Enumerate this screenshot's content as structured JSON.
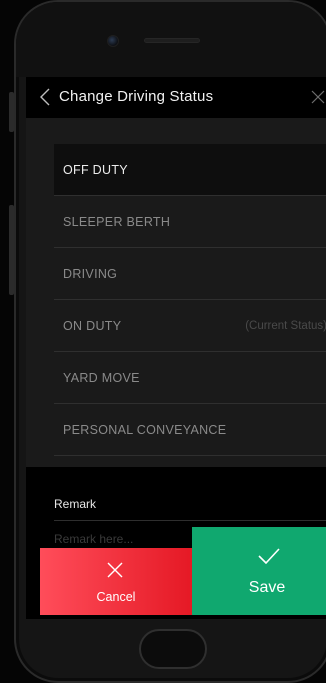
{
  "header": {
    "title": "Change Driving Status",
    "back_icon": "chevron-left-icon",
    "close_icon": "close-icon"
  },
  "statuses": [
    {
      "label": "OFF DUTY",
      "selected": true
    },
    {
      "label": "SLEEPER BERTH"
    },
    {
      "label": "DRIVING"
    },
    {
      "label": "ON DUTY",
      "note": "(Current Status)"
    },
    {
      "label": "YARD MOVE"
    },
    {
      "label": "PERSONAL CONVEYANCE"
    }
  ],
  "remark": {
    "label": "Remark",
    "placeholder": "Remark here..."
  },
  "actions": {
    "cancel_label": "Cancel",
    "cancel_icon": "close-icon",
    "save_label": "Save",
    "save_icon": "checkmark-icon"
  },
  "colors": {
    "cancel": "#ff2a3d",
    "save": "#10a86f",
    "header_bg": "#000000",
    "screen_bg": "#1a1a1a"
  }
}
